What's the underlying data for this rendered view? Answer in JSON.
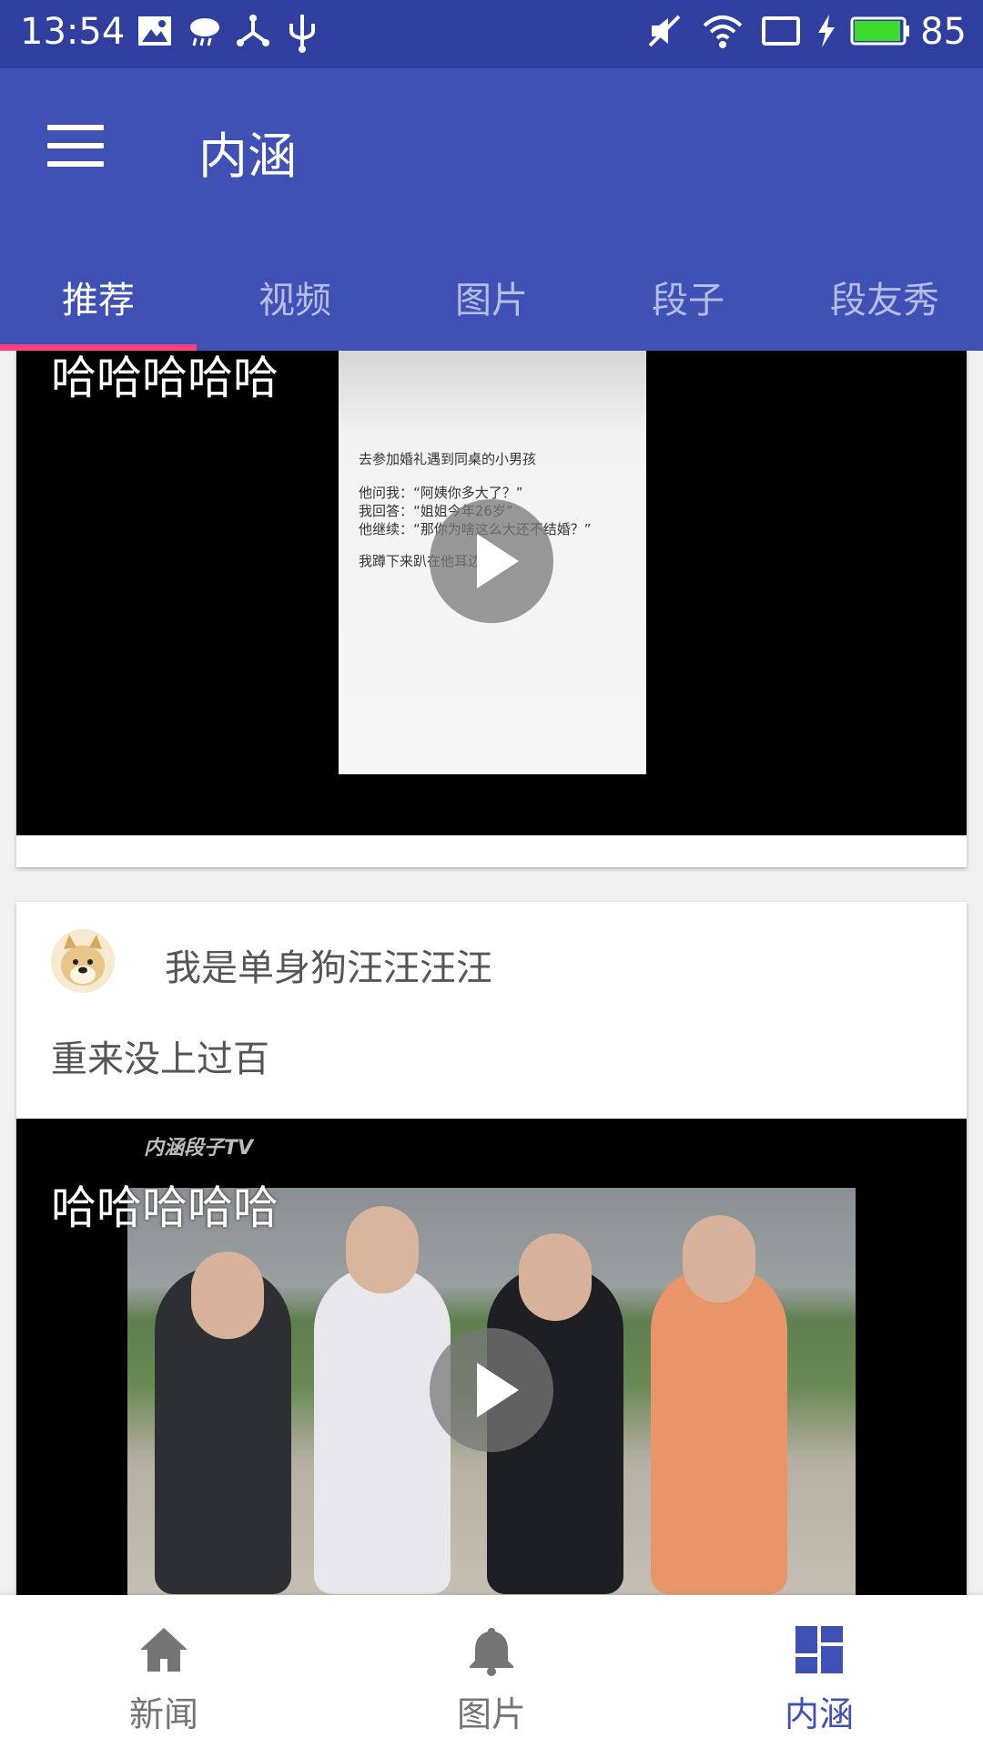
{
  "status_bar": {
    "time": "13:54",
    "battery_percent": "85",
    "icons": [
      "image-icon",
      "cloud-rain-icon",
      "share-node-icon",
      "usb-icon",
      "mute-icon",
      "wifi-icon",
      "screen-cast-icon",
      "charging-bolt-icon",
      "battery-icon"
    ]
  },
  "app_bar": {
    "title": "内涵",
    "menu_icon": "hamburger-menu-icon"
  },
  "tabs": [
    {
      "label": "推荐",
      "active": true
    },
    {
      "label": "视频",
      "active": false
    },
    {
      "label": "图片",
      "active": false
    },
    {
      "label": "段子",
      "active": false
    },
    {
      "label": "段友秀",
      "active": false
    }
  ],
  "posts": [
    {
      "video_caption": "哈哈哈哈哈",
      "thumbnail_text": [
        "去参加婚礼遇到同桌的小男孩",
        "",
        "他问我：“阿姨你多大了？”",
        "我回答：“姐姐今年26岁”",
        "他继续：“那你为啥这么大还不结婚？”",
        "",
        "我蹲下来趴在他耳边说："
      ]
    },
    {
      "author": "我是单身狗汪汪汪汪",
      "text": "重来没上过百",
      "video_caption": "哈哈哈哈哈",
      "watermark": "内涵段子TV"
    }
  ],
  "bottom_nav": [
    {
      "label": "新闻",
      "icon": "home-icon",
      "active": false
    },
    {
      "label": "图片",
      "icon": "bell-icon",
      "active": false
    },
    {
      "label": "内涵",
      "icon": "dashboard-icon",
      "active": true
    }
  ],
  "colors": {
    "status_bar": "#303f9f",
    "primary": "#3f51b5",
    "accent": "#ff4081"
  }
}
